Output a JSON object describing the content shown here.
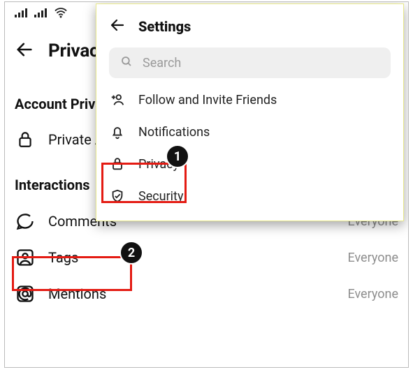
{
  "background": {
    "header_title": "Privacy",
    "section_account": "Account Privacy",
    "private_label": "Private Account",
    "section_interactions": "Interactions",
    "rows": {
      "comments_label": "Comments",
      "comments_value": "Everyone",
      "tags_label": "Tags",
      "tags_value": "Everyone",
      "mentions_label": "Mentions",
      "mentions_value": "Everyone"
    }
  },
  "overlay": {
    "header_title": "Settings",
    "search_placeholder": "Search",
    "rows": {
      "follow_label": "Follow and Invite Friends",
      "notifications_label": "Notifications",
      "privacy_label": "Privacy",
      "security_label": "Security"
    }
  },
  "steps": {
    "s1": "1",
    "s2": "2"
  },
  "colors": {
    "highlight": "#e41b13",
    "badge_bg": "#111111",
    "muted_text": "#8e8e8e",
    "search_bg": "#efefef"
  }
}
